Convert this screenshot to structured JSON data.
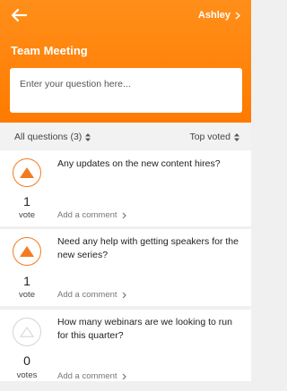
{
  "header": {
    "user_name": "Ashley",
    "title": "Team Meeting",
    "input_placeholder": "Enter your question here..."
  },
  "filters": {
    "left_label": "All questions (3)",
    "right_label": "Top voted"
  },
  "questions": [
    {
      "text": "Any updates on the new content hires?",
      "votes": "1",
      "vote_label": "vote",
      "comment_label": "Add a comment",
      "voted": true
    },
    {
      "text": "Need any help with getting speakers for the new series?",
      "votes": "1",
      "vote_label": "vote",
      "comment_label": "Add a comment",
      "voted": true
    },
    {
      "text": "How many webinars are we looking to run for this quarter?",
      "votes": "0",
      "vote_label": "votes",
      "comment_label": "Add a comment",
      "voted": false
    }
  ],
  "colors": {
    "accent": "#ff7a00",
    "vote_active": "#f47a1f",
    "vote_inactive": "#d4d4d4"
  }
}
